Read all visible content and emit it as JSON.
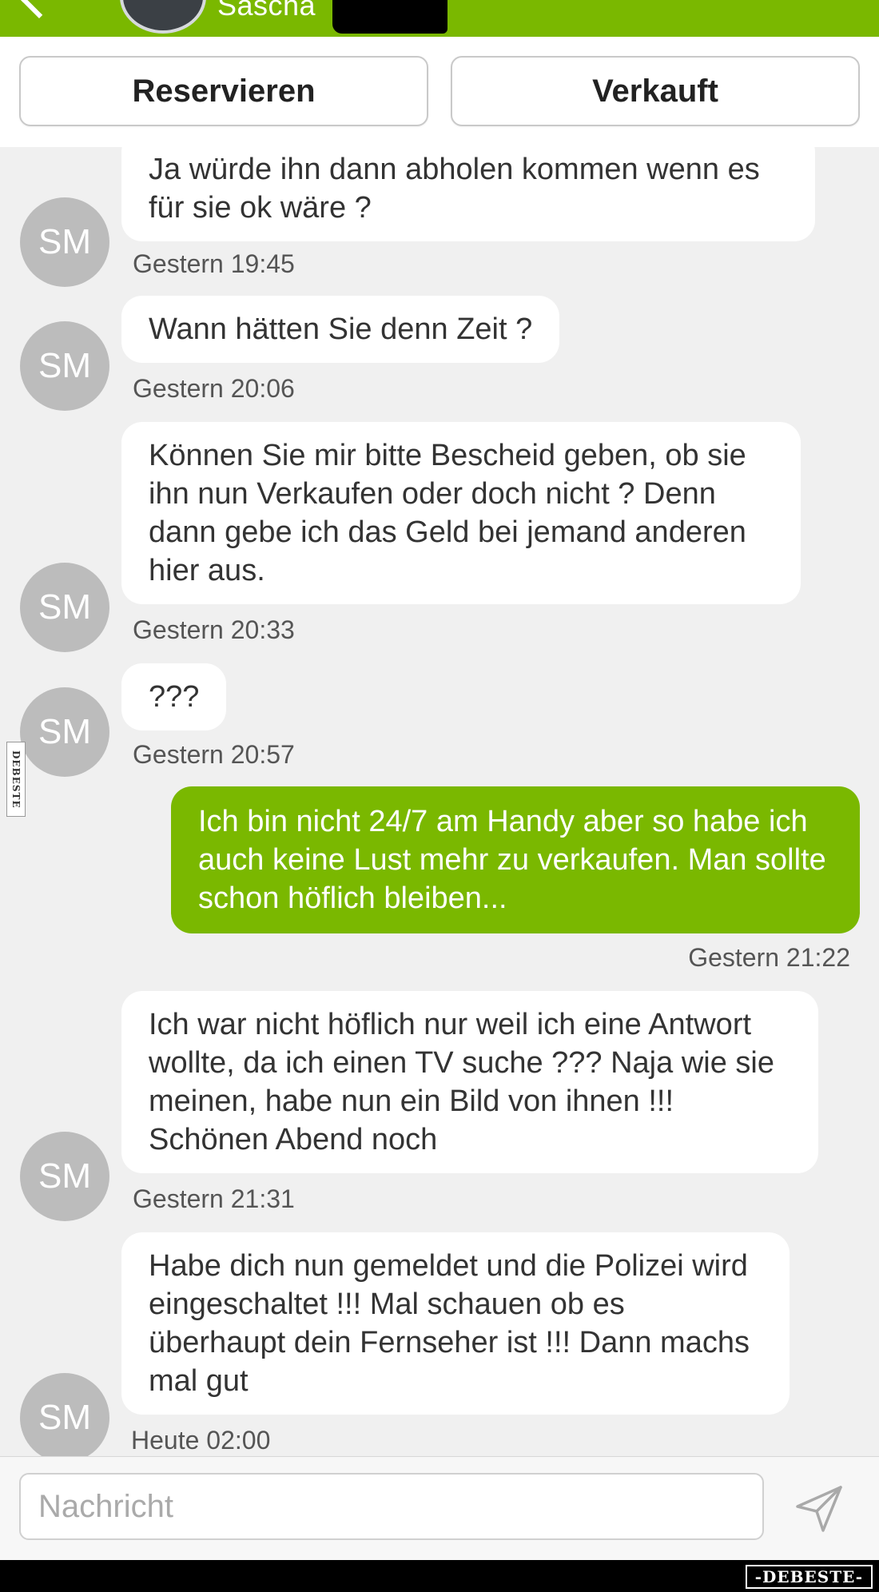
{
  "header": {
    "contact_name": "Sascha",
    "back_icon": "chevron-left-icon",
    "bar_color": "#7ab800"
  },
  "actions": {
    "reserve_label": "Reservieren",
    "sold_label": "Verkauft"
  },
  "messages": [
    {
      "direction": "in",
      "avatar": "SM",
      "text": "Ja würde ihn dann abholen kommen wenn es für sie ok wäre ?",
      "time": "Gestern 19:45"
    },
    {
      "direction": "in",
      "avatar": "SM",
      "text": "Wann hätten Sie denn Zeit ?",
      "time": "Gestern 20:06"
    },
    {
      "direction": "in",
      "avatar": "SM",
      "text": "Können Sie mir bitte Bescheid geben, ob sie ihn nun Verkaufen oder doch nicht ? Denn dann gebe ich das Geld bei jemand anderen hier aus.",
      "time": "Gestern 20:33"
    },
    {
      "direction": "in",
      "avatar": "SM",
      "text": "???",
      "time": "Gestern 20:57"
    },
    {
      "direction": "out",
      "text": "Ich bin nicht 24/7 am Handy aber so habe ich auch keine Lust mehr zu verkaufen. Man sollte schon höflich bleiben...",
      "time": "Gestern 21:22"
    },
    {
      "direction": "in",
      "avatar": "SM",
      "text": "Ich war nicht höflich nur weil ich eine Antwort wollte, da ich einen TV suche ??? Naja wie sie meinen, habe nun ein Bild von ihnen !!! Schönen Abend noch",
      "time": "Gestern 21:31"
    },
    {
      "direction": "in",
      "avatar": "SM",
      "text": "Habe dich nun gemeldet und die Polizei wird eingeschaltet !!! Mal schauen ob es überhaupt dein Fernseher ist !!! Dann machs mal gut",
      "time": "Heute 02:00"
    }
  ],
  "composer": {
    "placeholder": "Nachricht",
    "value": "",
    "send_icon": "send-icon"
  },
  "watermark": {
    "side": "DEBESTE",
    "footer": "-DEBESTE-"
  },
  "colors": {
    "accent_green": "#7ab800",
    "avatar_gray": "#bcbcbc",
    "chat_background": "#f0f0f0"
  }
}
